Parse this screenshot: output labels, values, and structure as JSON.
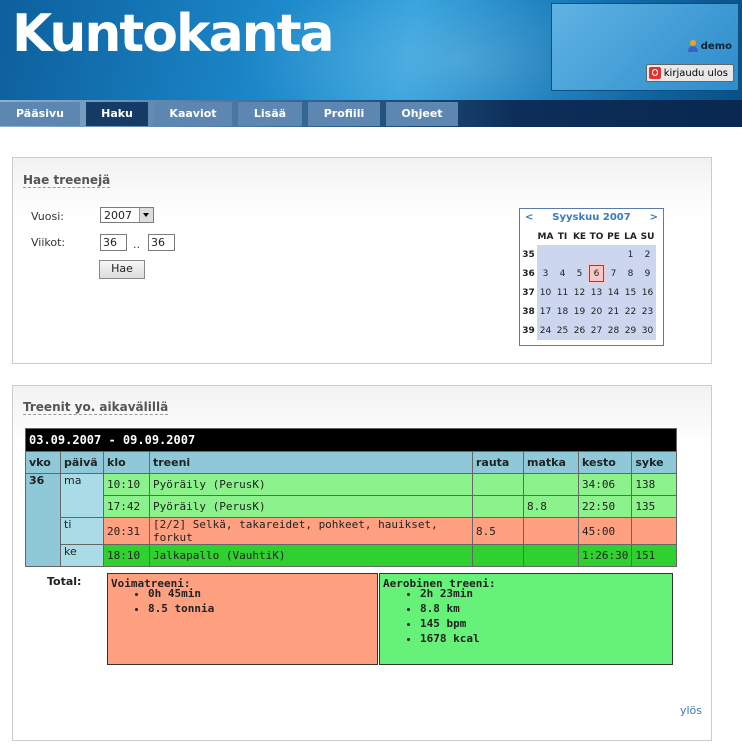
{
  "app": {
    "logo": "Kuntokanta",
    "user": "demo",
    "logout_label": "kirjaudu ulos"
  },
  "nav": {
    "tabs": [
      "Pääsivu",
      "Haku",
      "Kaaviot",
      "Lisää",
      "Profiili",
      "Ohjeet"
    ],
    "active": "Haku"
  },
  "search": {
    "title": "Hae treenejä",
    "year_label": "Vuosi:",
    "year_value": "2007",
    "weeks_label": "Viikot:",
    "week_from": "36",
    "week_sep": "..",
    "week_to": "36",
    "submit_label": "Hae"
  },
  "calendar": {
    "prev": "<",
    "next": ">",
    "title": "Syyskuu 2007",
    "weekdays": [
      "MA",
      "TI",
      "KE",
      "TO",
      "PE",
      "LA",
      "SU"
    ],
    "weeks": [
      {
        "wk": "35",
        "days": [
          "",
          "",
          "",
          "",
          "",
          "1",
          "2"
        ]
      },
      {
        "wk": "36",
        "days": [
          "3",
          "4",
          "5",
          "6",
          "7",
          "8",
          "9"
        ]
      },
      {
        "wk": "37",
        "days": [
          "10",
          "11",
          "12",
          "13",
          "14",
          "15",
          "16"
        ]
      },
      {
        "wk": "38",
        "days": [
          "17",
          "18",
          "19",
          "20",
          "21",
          "22",
          "23"
        ]
      },
      {
        "wk": "39",
        "days": [
          "24",
          "25",
          "26",
          "27",
          "28",
          "29",
          "30"
        ]
      }
    ],
    "today": "6"
  },
  "results": {
    "title": "Treenit yo. aikavälillä",
    "range": "03.09.2007 - 09.09.2007",
    "headers": {
      "vko": "vko",
      "paiva": "päivä",
      "klo": "klo",
      "treeni": "treeni",
      "rauta": "rauta",
      "matka": "matka",
      "kesto": "kesto",
      "syke": "syke"
    },
    "week": "36",
    "rows": [
      {
        "day": "ma",
        "klo": "10:10",
        "treeni": "Pyöräily (PerusK)",
        "rauta": "",
        "matka": "",
        "kesto": "34:06",
        "syke": "138"
      },
      {
        "day": "",
        "klo": "17:42",
        "treeni": "Pyöräily (PerusK)",
        "rauta": "",
        "matka": "8.8",
        "kesto": "22:50",
        "syke": "135"
      },
      {
        "day": "ti",
        "klo": "20:31",
        "treeni": "[2/2] Selkä, takareidet, pohkeet, hauikset, forkut",
        "rauta": "8.5",
        "matka": "",
        "kesto": "45:00",
        "syke": ""
      },
      {
        "day": "ke",
        "klo": "18:10",
        "treeni": "Jalkapallo (VauhtiK)",
        "rauta": "",
        "matka": "",
        "kesto": "1:26:30",
        "syke": "151"
      }
    ],
    "total_label": "Total:",
    "strength": {
      "title": "Voimatreeni:",
      "items": [
        "0h 45min",
        "8.5 tonnia"
      ]
    },
    "aerobic": {
      "title": "Aerobinen treeni:",
      "items": [
        "2h 23min",
        "8.8 km",
        "145 bpm",
        "1678 kcal"
      ]
    },
    "up_link": "ylös"
  }
}
